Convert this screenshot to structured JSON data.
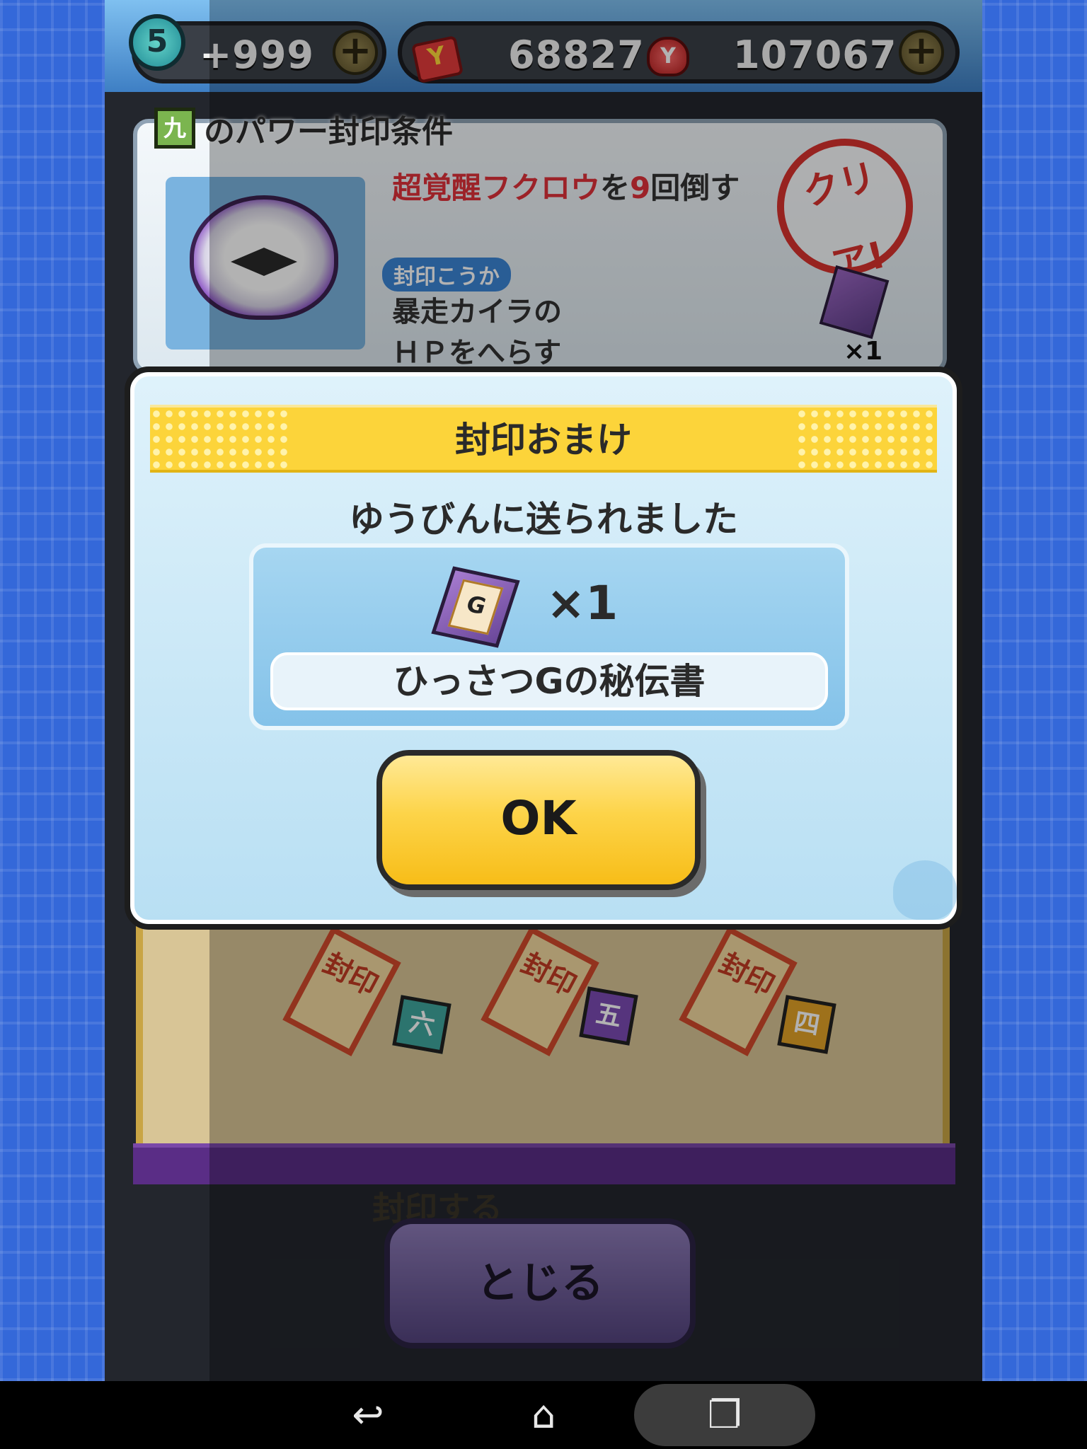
{
  "topbar": {
    "stamina_level": "5",
    "stamina_value": "+999",
    "ycoins": "68827",
    "money": "107067",
    "plus_glyph": "+"
  },
  "condition_card": {
    "kanji_badge": "九",
    "title": "のパワー封印条件",
    "condition_red": "超覚醒フクロウ",
    "condition_mid": "を",
    "condition_count": "9",
    "condition_end": "回倒す",
    "effect_tag": "封印こうか",
    "effect_line1": "暴走カイラの",
    "effect_line2": "ＨＰをへらす",
    "clear_stamp": "クリア!",
    "reward_qty": "×1"
  },
  "lower_scene": {
    "seals": [
      {
        "label": "封印",
        "badge": "六",
        "badge_color": "#3fa79e"
      },
      {
        "label": "封印",
        "badge": "五",
        "badge_color": "#7b4bb3"
      },
      {
        "label": "封印",
        "badge": "四",
        "badge_color": "#e3a228"
      }
    ],
    "under_text": "封印する",
    "close_button": "とじる"
  },
  "modal": {
    "title": "封印おまけ",
    "message": "ゆうびんに送られました",
    "item_book_letter": "G",
    "item_qty": "×1",
    "item_name": "ひっさつGの秘伝書",
    "ok_button": "OK"
  },
  "navbar": {
    "back_icon": "↩",
    "home_icon": "⌂",
    "recents_icon": "❐"
  },
  "colors": {
    "accent_yellow": "#fcd43a",
    "panel_blue": "#84c2e9",
    "condition_red": "#e0313a",
    "side_blue": "#3468d9"
  }
}
